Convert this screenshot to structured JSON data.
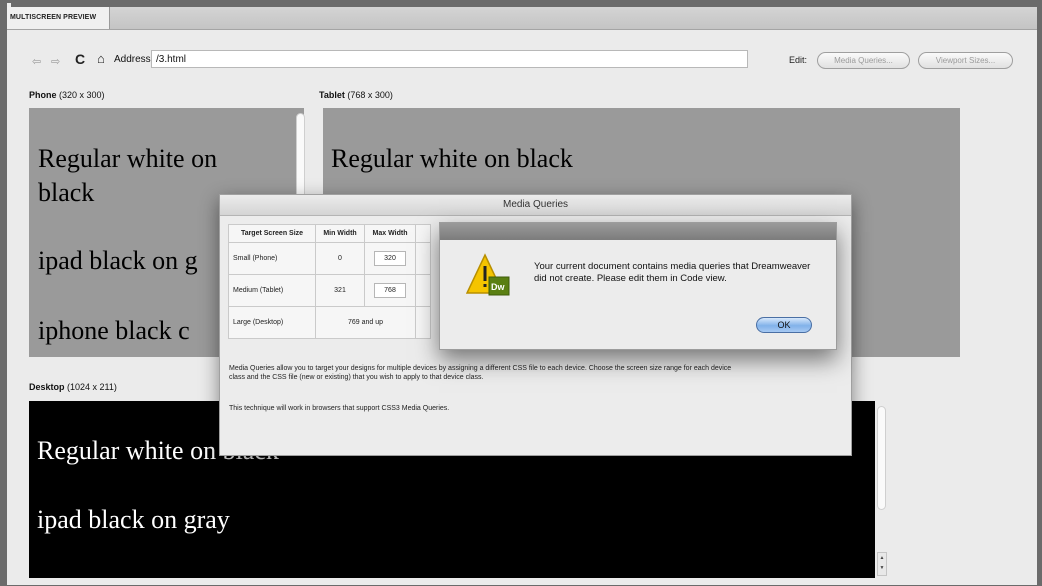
{
  "panel": {
    "tab_label": "MULTISCREEN PREVIEW"
  },
  "toolbar": {
    "back_icon": "back-arrow-icon",
    "forward_icon": "forward-arrow-icon",
    "refresh_icon": "refresh-icon",
    "home_icon": "home-icon",
    "address_label": "Address:",
    "address_value": "/3.html",
    "edit_label": "Edit:",
    "media_queries_button": "Media Queries...",
    "viewport_sizes_button": "Viewport Sizes..."
  },
  "phone": {
    "title": "Phone",
    "size": "(320 x 300)",
    "lines": [
      "Regular white on",
      "black",
      "ipad black on g",
      "iphone black c"
    ]
  },
  "tablet": {
    "title": "Tablet",
    "size": "(768 x 300)",
    "lines": [
      "Regular white on black"
    ]
  },
  "desktop": {
    "title": "Desktop",
    "size": "(1024 x 211)",
    "lines": [
      "Regular white on black",
      "ipad black on gray"
    ]
  },
  "media_queries_dialog": {
    "title": "Media Queries",
    "columns": [
      "Target Screen Size",
      "Min Width",
      "Max Width"
    ],
    "rows": [
      {
        "label": "Small (Phone)",
        "min": "0",
        "max": "320"
      },
      {
        "label": "Medium (Tablet)",
        "min": "321",
        "max": "768"
      },
      {
        "label": "Large (Desktop)",
        "range": "769 and up"
      }
    ],
    "description": "Media Queries allow you to target your designs for multiple devices by assigning a different CSS file to each device. Choose the screen size range for each device class and the CSS file (new or existing) that you wish to apply to that device class.",
    "note": "This technique will work in browsers that support CSS3 Media Queries."
  },
  "alert": {
    "icon": "warning-dreamweaver-icon",
    "badge": "Dw",
    "message": "Your current document contains media queries that Dreamweaver did not create. Please edit them in Code view.",
    "ok_label": "OK"
  },
  "colors": {
    "preview_gray": "#9a9a9a",
    "desktop_bg": "#000000",
    "panel_bg": "#ebebeb",
    "ok_button": "#82b2ea",
    "warning": "#f5c400"
  }
}
